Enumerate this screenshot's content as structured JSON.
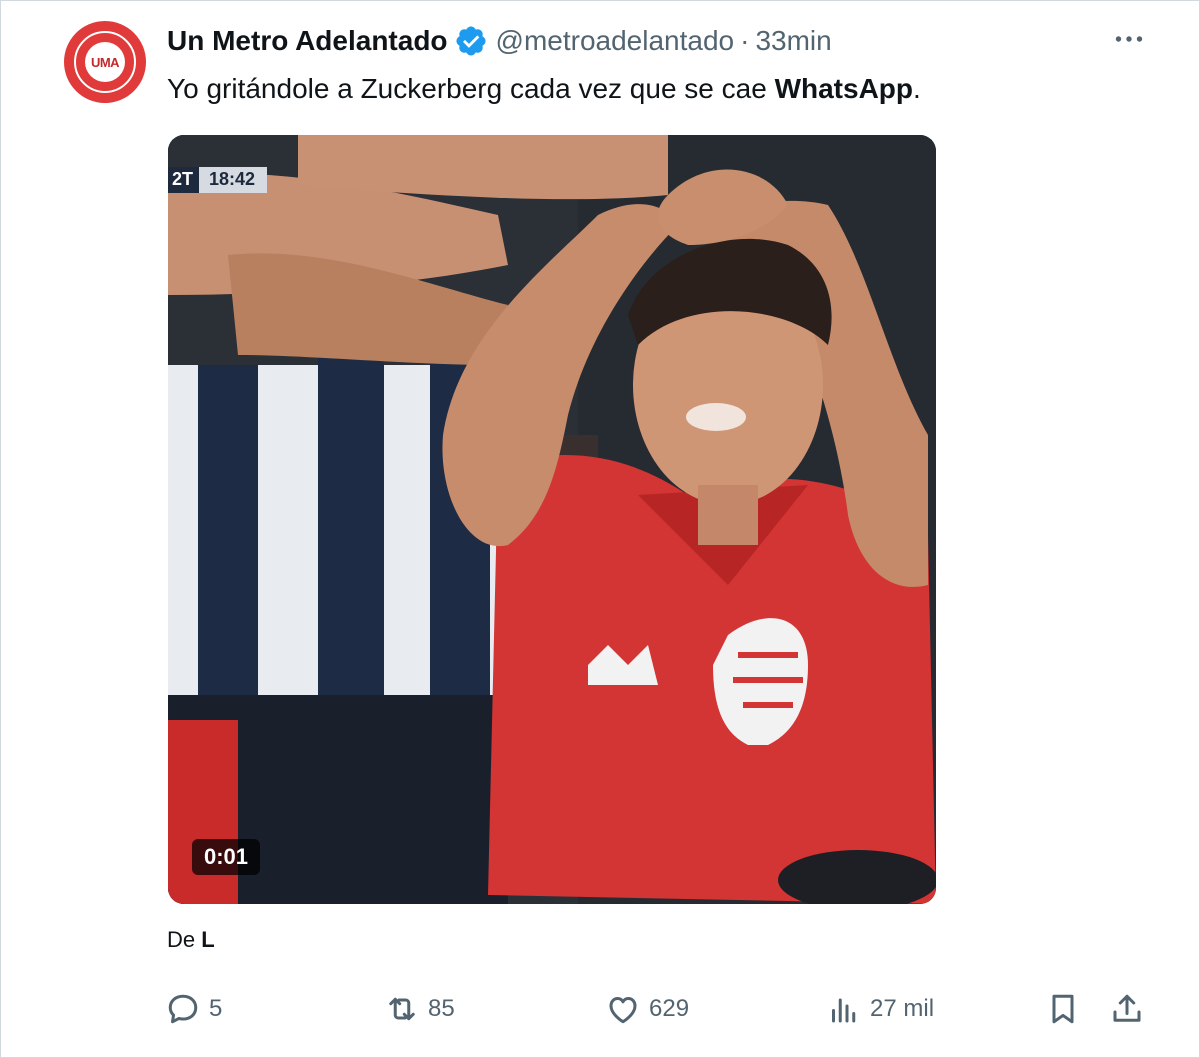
{
  "tweet": {
    "avatar_text": "UMA",
    "display_name": "Un Metro Adelantado",
    "handle": "@metroadelantado",
    "separator": "·",
    "time": "33min",
    "text_before": "Yo gritándole a Zuckerberg cada vez que se cae ",
    "text_bold": "WhatsApp",
    "text_after": "."
  },
  "video": {
    "score_period": "2T",
    "score_clock": "18:42",
    "duration": "0:01"
  },
  "source": {
    "prefix": "De",
    "author": "L"
  },
  "actions": {
    "replies": "5",
    "reposts": "85",
    "likes": "629",
    "views": "27 mil"
  },
  "colors": {
    "verified": "#1d9bf0",
    "secondary_text": "#536471",
    "primary_text": "#0f1419",
    "avatar_red": "#e03a3a"
  }
}
